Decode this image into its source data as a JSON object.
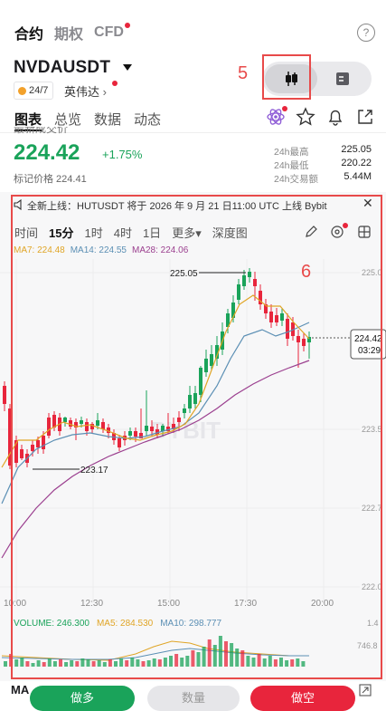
{
  "top_tabs": [
    {
      "label": "合约"
    },
    {
      "label": "期权"
    },
    {
      "label": "CFD"
    }
  ],
  "help_label": "?",
  "symbol": "NVDAUSDT",
  "session_tag": "24/7",
  "company": "英伟达",
  "annotations": {
    "toggle_number": "5",
    "chart_number": "6"
  },
  "sub_tabs": [
    {
      "label": "图表"
    },
    {
      "label": "总览"
    },
    {
      "label": "数据"
    },
    {
      "label": "动态"
    }
  ],
  "price_partial_label": "最新成交价",
  "last_price": "224.42",
  "change_pct": "+1.75%",
  "mark_price": "标记价格 224.41",
  "stats": [
    {
      "label": "24h最高",
      "value": "225.05"
    },
    {
      "label": "24h最低",
      "value": "220.22"
    },
    {
      "label": "24h交易额",
      "value": "5.44M"
    }
  ],
  "ticker_text": "全新上线：HUTUSDT 将于 2026 年 9 月 21 日11:00 UTC 上线 Bybit",
  "intervals": [
    "时间",
    "15分",
    "1时",
    "4时",
    "1日",
    "更多▾",
    "深度图"
  ],
  "ma_legend": [
    {
      "text": "MA7: 224.48",
      "color": "#e0a526"
    },
    {
      "text": "MA14: 224.55",
      "color": "#5b8fb4"
    },
    {
      "text": "MA28: 224.06",
      "color": "#9b3f8f"
    }
  ],
  "chart_data": {
    "type": "candlestick",
    "y_ticks": [
      "225.0",
      "223.5",
      "222.7",
      "222.0"
    ],
    "x_ticks": [
      "10:00",
      "12:30",
      "15:00",
      "17:30",
      "20:00"
    ],
    "high_label": "225.05",
    "low_label": "223.17",
    "current_price": "224.42",
    "countdown": "03:29",
    "watermark": "BYBIT"
  },
  "volume_legend": {
    "volume": "VOLUME: 246.300",
    "ma5": "MA5: 284.530",
    "ma10": "MA10: 298.777",
    "vol_tick_1": "1.4",
    "vol_tick_2": "746.8"
  },
  "ma_bottom_label": "MA",
  "buttons": {
    "long": "做多",
    "qty": "数量",
    "short": "做空"
  },
  "colors": {
    "up": "#1aa35a",
    "down": "#e8253c",
    "annotation": "#e84a4a"
  }
}
